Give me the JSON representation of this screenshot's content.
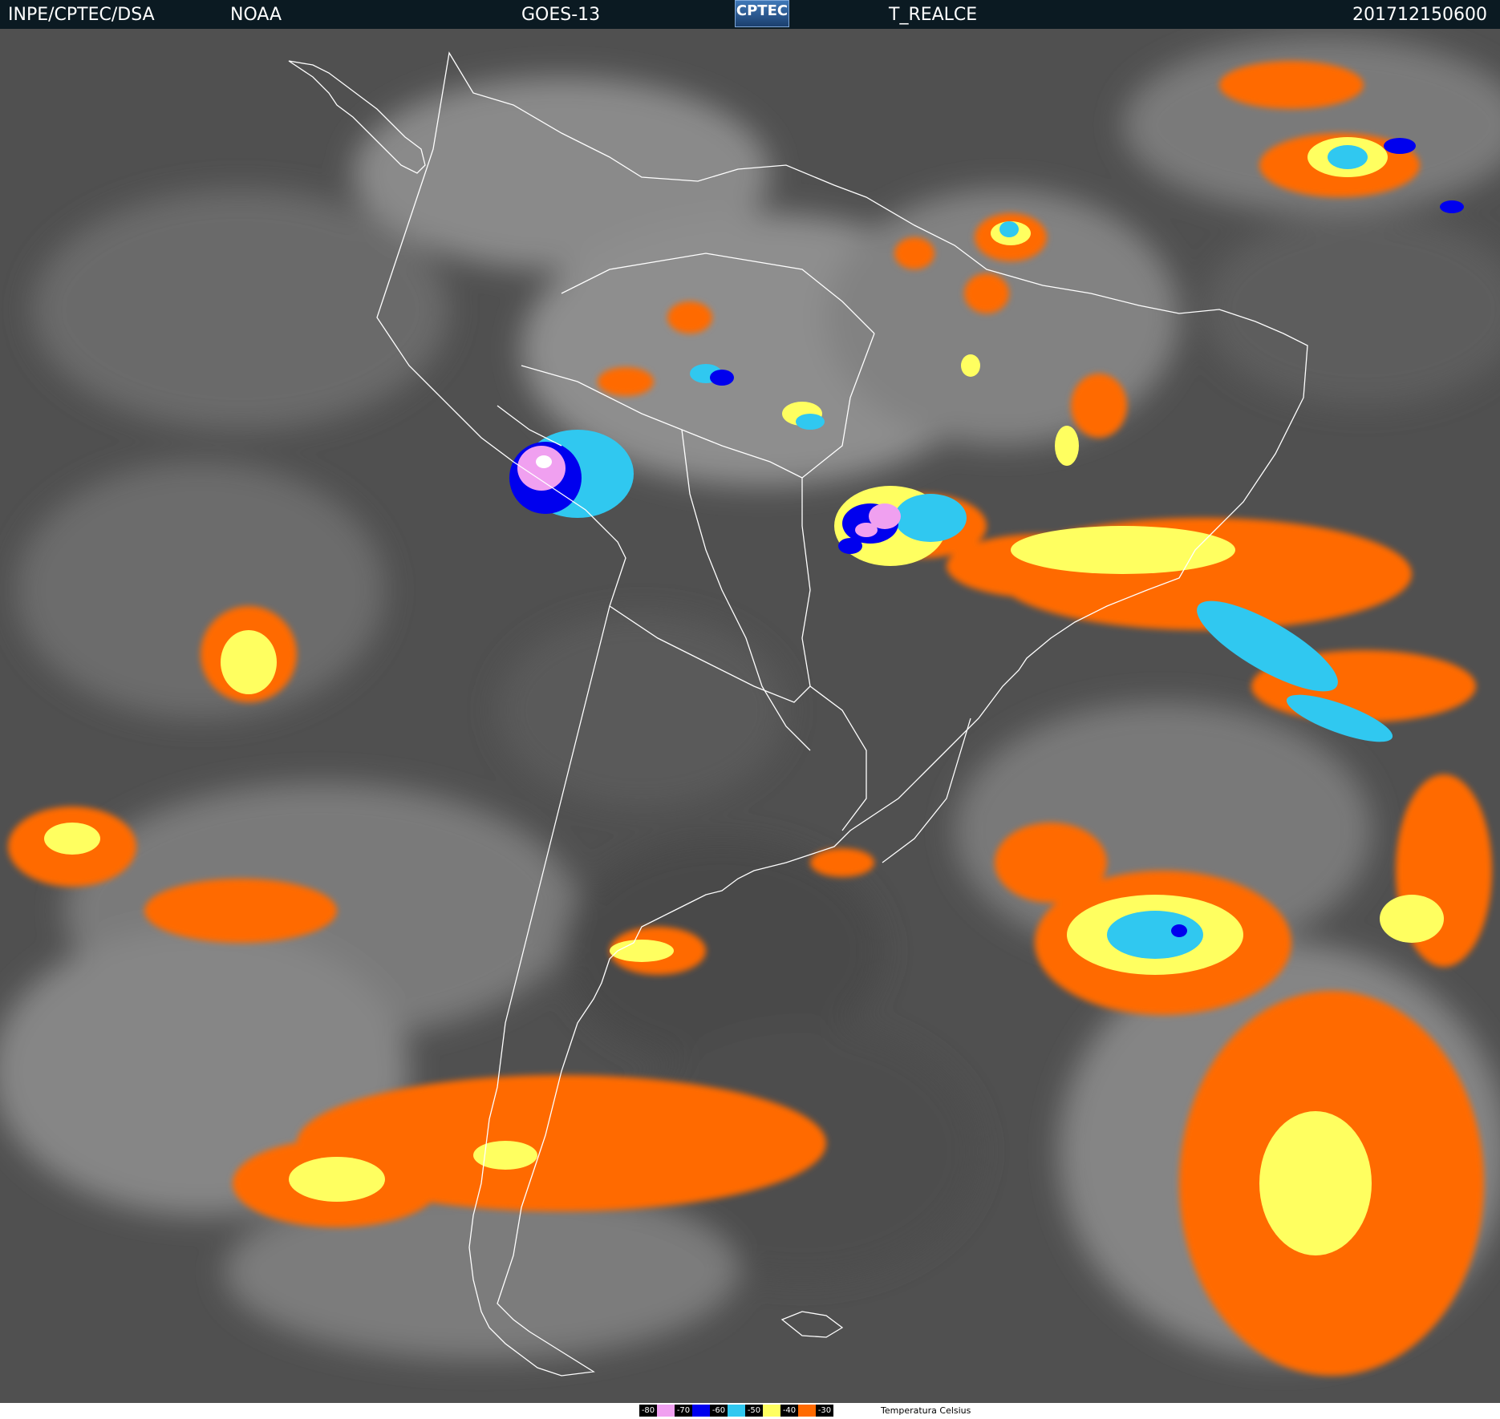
{
  "header": {
    "organization": "INPE/CPTEC/DSA",
    "agency": "NOAA",
    "satellite": "GOES-13",
    "logo_text": "CPTEC",
    "product": "T_REALCE",
    "timestamp": "201712150600"
  },
  "legend": {
    "title": "Temperatura   Celsius",
    "entries": [
      {
        "label": "-80",
        "color": "#f0a0f0"
      },
      {
        "label": "-70",
        "color": "#0000ee"
      },
      {
        "label": "-60",
        "color": "#30c8f0"
      },
      {
        "label": "-50",
        "color": "#ffff60"
      },
      {
        "label": "-40",
        "color": "#ff6a00"
      },
      {
        "label": "-30",
        "color": "#ffffff"
      }
    ]
  },
  "colors": {
    "background_gray": "#555555",
    "header_bg": "#0b1a22",
    "outline": "#ffffff"
  }
}
